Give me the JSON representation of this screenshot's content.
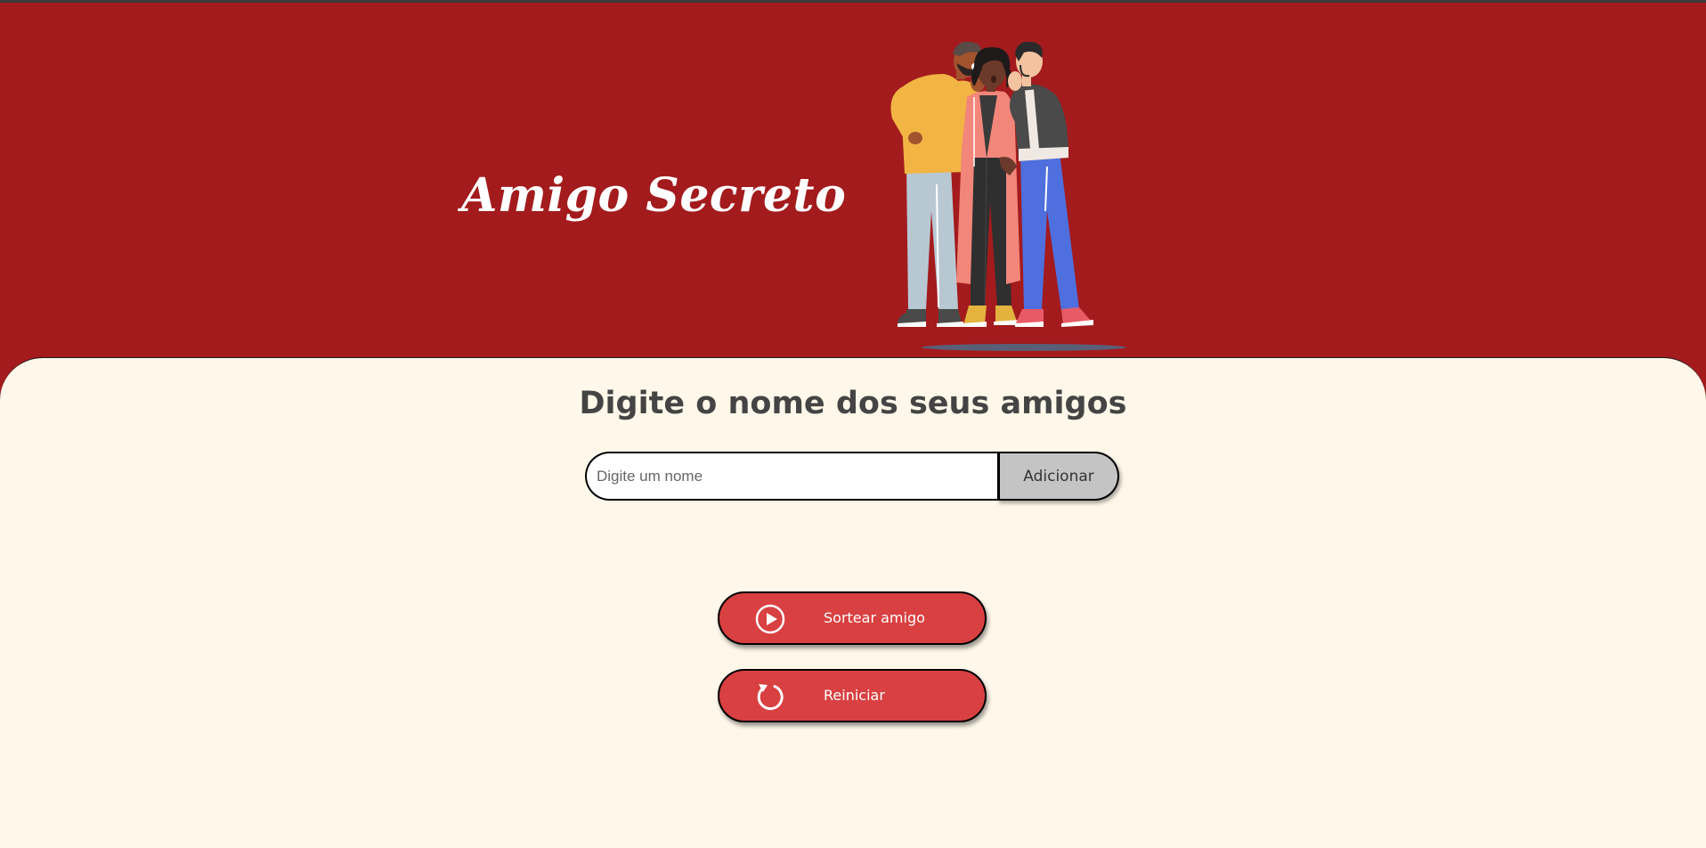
{
  "header": {
    "title": "Amigo Secreto",
    "background_color": "#A31B1D",
    "illustration": "three-friends-whispering-illustration"
  },
  "main": {
    "background_color": "#FFF8EA",
    "heading": "Digite o nome dos seus amigos",
    "name_input": {
      "value": "",
      "placeholder": "Digite um nome"
    },
    "add_button_label": "Adicionar",
    "draw_button": {
      "label": "Sortear amigo",
      "icon": "play-circle-icon",
      "color": "#D94041"
    },
    "reset_button": {
      "label": "Reiniciar",
      "icon": "refresh-icon",
      "color": "#D94041"
    }
  }
}
